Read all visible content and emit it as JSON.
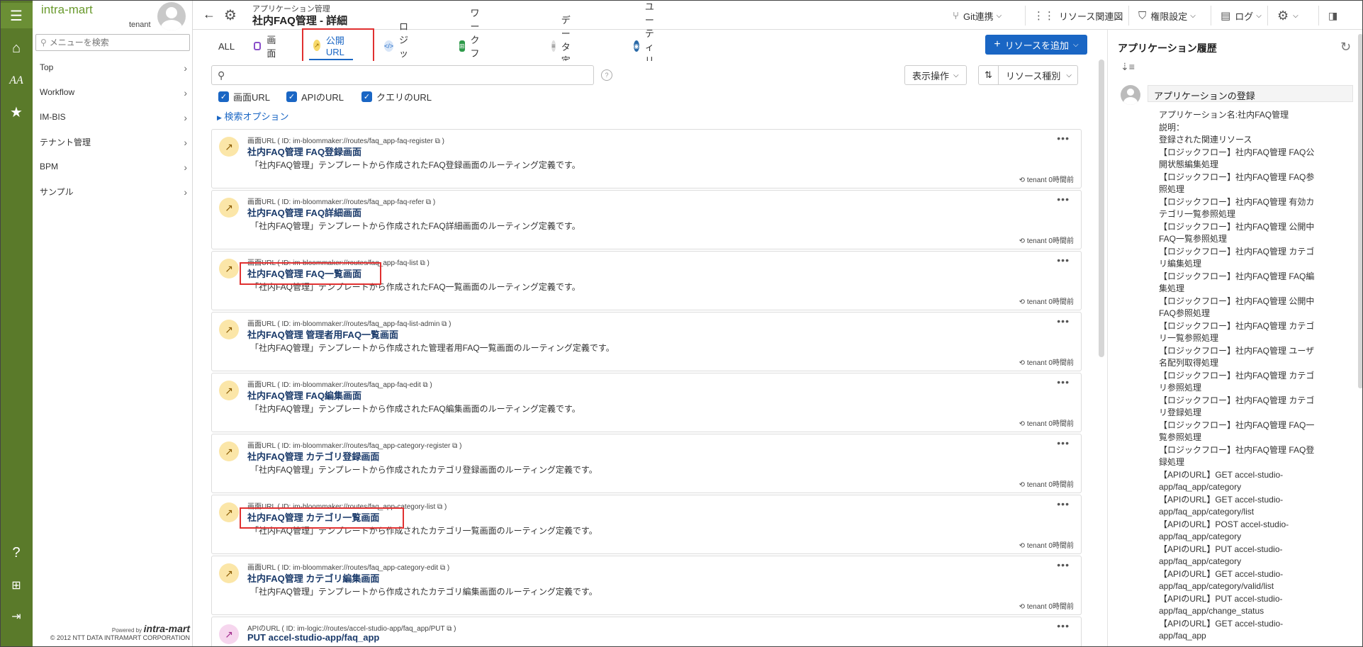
{
  "iconbar": {
    "items": [
      "menu-icon",
      "home-icon",
      "font-size-icon",
      "star-icon",
      "help-icon",
      "sitemap-icon",
      "logout-icon"
    ]
  },
  "sidemenu": {
    "logo": "intra-mart",
    "user": "tenant",
    "search_placeholder": "メニューを検索",
    "items": [
      {
        "label": "Top"
      },
      {
        "label": "Workflow"
      },
      {
        "label": "IM-BIS"
      },
      {
        "label": "テナント管理"
      },
      {
        "label": "BPM"
      },
      {
        "label": "サンプル"
      }
    ],
    "powered_by": "Powered by",
    "brand": "intra-mart",
    "copyright": "© 2012 NTT DATA INTRAMART CORPORATION"
  },
  "header": {
    "breadcrumb": "アプリケーション管理",
    "title": "社内FAQ管理 - 詳細",
    "git": "Git連携",
    "resource_graph": "リソース関連図",
    "permission": "権限設定",
    "log": "ログ"
  },
  "tabs": [
    {
      "label": "ALL"
    },
    {
      "label": "画面"
    },
    {
      "label": "公開URL"
    },
    {
      "label": "ロジック"
    },
    {
      "label": "ワークフロー"
    },
    {
      "label": "データ定義"
    },
    {
      "label": "ユーティリティ"
    }
  ],
  "add_button": "リソースを追加",
  "filters": {
    "display_action": "表示操作",
    "resource_type": "リソース種別",
    "checkboxes": [
      {
        "label": "画面URL"
      },
      {
        "label": "APIのURL"
      },
      {
        "label": "クエリのURL"
      }
    ],
    "search_option": "検索オプション"
  },
  "cards": [
    {
      "type": "画面URL ( ID: im-bloommaker://routes/faq_app-faq-register",
      "title": "社内FAQ管理 FAQ登録画面",
      "desc": "「社内FAQ管理」テンプレートから作成されたFAQ登録画面のルーティング定義です。",
      "time": "tenant 0時間前",
      "kind": "screen"
    },
    {
      "type": "画面URL ( ID: im-bloommaker://routes/faq_app-faq-refer",
      "title": "社内FAQ管理 FAQ詳細画面",
      "desc": "「社内FAQ管理」テンプレートから作成されたFAQ詳細画面のルーティング定義です。",
      "time": "tenant 0時間前",
      "kind": "screen"
    },
    {
      "type": "画面URL ( ID: im-bloommaker://routes/faq_app-faq-list",
      "title": "社内FAQ管理 FAQ一覧画面",
      "desc": "「社内FAQ管理」テンプレートから作成されたFAQ一覧画面のルーティング定義です。",
      "time": "tenant 0時間前",
      "kind": "screen"
    },
    {
      "type": "画面URL ( ID: im-bloommaker://routes/faq_app-faq-list-admin",
      "title": "社内FAQ管理 管理者用FAQ一覧画面",
      "desc": "「社内FAQ管理」テンプレートから作成された管理者用FAQ一覧画面のルーティング定義です。",
      "time": "tenant 0時間前",
      "kind": "screen"
    },
    {
      "type": "画面URL ( ID: im-bloommaker://routes/faq_app-faq-edit",
      "title": "社内FAQ管理 FAQ編集画面",
      "desc": "「社内FAQ管理」テンプレートから作成されたFAQ編集画面のルーティング定義です。",
      "time": "tenant 0時間前",
      "kind": "screen"
    },
    {
      "type": "画面URL ( ID: im-bloommaker://routes/faq_app-category-register",
      "title": "社内FAQ管理 カテゴリ登録画面",
      "desc": "「社内FAQ管理」テンプレートから作成されたカテゴリ登録画面のルーティング定義です。",
      "time": "tenant 0時間前",
      "kind": "screen"
    },
    {
      "type": "画面URL ( ID: im-bloommaker://routes/faq_app-category-list",
      "title": "社内FAQ管理 カテゴリ一覧画面",
      "desc": "「社内FAQ管理」テンプレートから作成されたカテゴリ一覧画面のルーティング定義です。",
      "time": "tenant 0時間前",
      "kind": "screen"
    },
    {
      "type": "画面URL ( ID: im-bloommaker://routes/faq_app-category-edit",
      "title": "社内FAQ管理 カテゴリ編集画面",
      "desc": "「社内FAQ管理」テンプレートから作成されたカテゴリ編集画面のルーティング定義です。",
      "time": "tenant 0時間前",
      "kind": "screen"
    },
    {
      "type": "APIのURL ( ID: im-logic://routes/accel-studio-app/faq_app/PUT",
      "title": "PUT accel-studio-app/faq_app",
      "desc": "",
      "time": "",
      "kind": "api"
    }
  ],
  "history": {
    "title": "アプリケーション履歴",
    "entry_head": "アプリケーションの登録",
    "lines": [
      "アプリケーション名:社内FAQ管理",
      "説明：",
      "登録された関連リソース",
      "【ロジックフロー】社内FAQ管理 FAQ公",
      "開状態編集処理",
      "【ロジックフロー】社内FAQ管理 FAQ参",
      "照処理",
      "【ロジックフロー】社内FAQ管理 有効カ",
      "テゴリ一覧参照処理",
      "【ロジックフロー】社内FAQ管理 公開中",
      "FAQ一覧参照処理",
      "【ロジックフロー】社内FAQ管理 カテゴ",
      "リ編集処理",
      "【ロジックフロー】社内FAQ管理 FAQ編",
      "集処理",
      "【ロジックフロー】社内FAQ管理 公開中",
      "FAQ参照処理",
      "【ロジックフロー】社内FAQ管理 カテゴ",
      "リ一覧参照処理",
      "【ロジックフロー】社内FAQ管理 ユーザ",
      "名配列取得処理",
      "【ロジックフロー】社内FAQ管理 カテゴ",
      "リ参照処理",
      "【ロジックフロー】社内FAQ管理 カテゴ",
      "リ登録処理",
      "【ロジックフロー】社内FAQ管理 FAQ一",
      "覧参照処理",
      "【ロジックフロー】社内FAQ管理 FAQ登",
      "録処理",
      "【APIのURL】GET accel-studio-",
      "app/faq_app/category",
      "【APIのURL】GET accel-studio-",
      "app/faq_app/category/list",
      "【APIのURL】POST accel-studio-",
      "app/faq_app/category",
      "【APIのURL】PUT accel-studio-",
      "app/faq_app/category",
      "【APIのURL】GET accel-studio-",
      "app/faq_app/category/valid/list",
      "【APIのURL】PUT accel-studio-",
      "app/faq_app/change_status",
      "【APIのURL】GET accel-studio-",
      "app/faq_app"
    ]
  },
  "colors": {
    "iconbar": "#5a7a2a",
    "accent": "#1a66c4",
    "highlight": "#e03030"
  }
}
